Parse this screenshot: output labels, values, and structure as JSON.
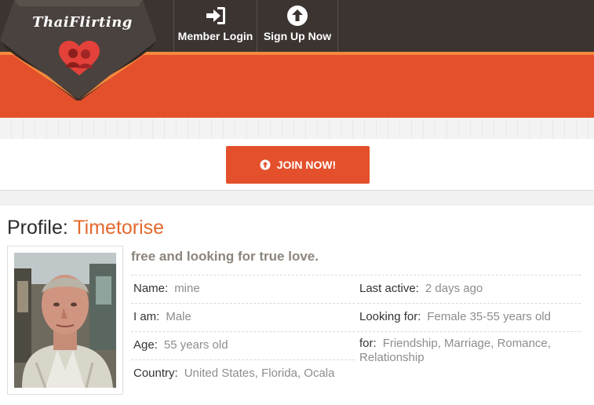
{
  "header": {
    "logo_text": "ThaiFlirting",
    "nav": {
      "login_label": "Member Login",
      "signup_label": "Sign Up Now"
    }
  },
  "join": {
    "label": "JOIN NOW!"
  },
  "profile": {
    "heading_prefix": "Profile:",
    "username": "Timetorise",
    "tagline": "free and looking for true love.",
    "fields": {
      "name_label": "Name:",
      "name_value": "mine",
      "iam_label": "I am:",
      "iam_value": "Male",
      "age_label": "Age:",
      "age_value": "55 years old",
      "country_label": "Country:",
      "country_value": "United States, Florida, Ocala",
      "last_active_label": "Last active:",
      "last_active_value": "2 days ago",
      "looking_for_label": "Looking for:",
      "looking_for_value": "Female 35-55 years old",
      "for_label": "for:",
      "for_value": "Friendship, Marriage, Romance, Relationship"
    }
  },
  "colors": {
    "accent": "#e3502b",
    "topbar": "#3b3431",
    "username": "#e3692f"
  },
  "icons": {
    "login": "sign-in-icon",
    "signup": "arrow-up-circle-icon",
    "join": "arrow-up-circle-icon",
    "logo": "heart-couple-icon"
  }
}
